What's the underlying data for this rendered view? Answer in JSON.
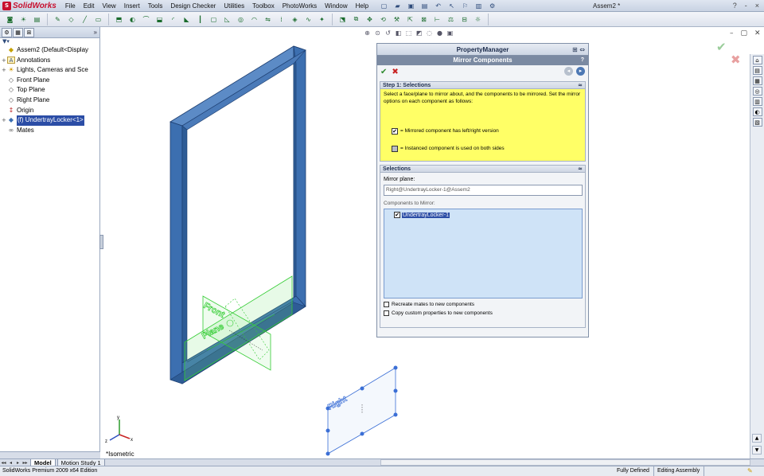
{
  "app": {
    "logo_text": "SolidWorks",
    "logo_mark": "S",
    "document_title": "Assem2 *",
    "help_glyphs": [
      "?",
      "-",
      "×"
    ]
  },
  "menus": [
    "File",
    "Edit",
    "View",
    "Insert",
    "Tools",
    "Design Checker",
    "Utilities",
    "Toolbox",
    "PhotoWorks",
    "Window",
    "Help"
  ],
  "feature_manager": {
    "tabs": [
      "⚙",
      "▦",
      "⊞"
    ],
    "expand_glyph": "»",
    "filter_glyph": "▼▾",
    "tree": [
      {
        "label": "Assem2  (Default<Display",
        "expander": "",
        "icon": "◆"
      },
      {
        "label": "Annotations",
        "expander": "+",
        "icon": "A"
      },
      {
        "label": "Lights, Cameras and Sce",
        "expander": "+",
        "icon": "☀"
      },
      {
        "label": "Front Plane",
        "expander": "",
        "icon": "◇"
      },
      {
        "label": "Top Plane",
        "expander": "",
        "icon": "◇"
      },
      {
        "label": "Right Plane",
        "expander": "",
        "icon": "◇"
      },
      {
        "label": "Origin",
        "expander": "",
        "icon": "↕"
      },
      {
        "label": "(f) UndertrayLocker<1>",
        "expander": "+",
        "icon": "◆",
        "selected": true
      },
      {
        "label": "Mates",
        "expander": "",
        "icon": "∞"
      }
    ]
  },
  "property_manager": {
    "header": "PropertyManager",
    "title": "Mirror Components",
    "help": "?",
    "ok_glyph": "✔",
    "cancel_glyph": "✖",
    "back_glyph": "◂",
    "next_glyph": "▸",
    "step1": {
      "heading": "Step 1: Selections",
      "instructions": "Select a face/plane to mirror about, and the components to be mirrored. Set the mirror options on each component as follows:",
      "legend_mirrored": "= Mirrored component has left/right version",
      "legend_instanced": "= Instanced component is used on both sides"
    },
    "selections": {
      "heading": "Selections",
      "mirror_plane_label": "Mirror plane:",
      "mirror_plane_value": "Right@UndertrayLocker-1@Assem2",
      "components_label": "Components to Mirror:",
      "components": [
        "UndertrayLocker-1"
      ]
    },
    "options": [
      {
        "label": "Recreate mates to new components",
        "checked": false
      },
      {
        "label": "Copy custom properties to new components",
        "checked": false
      }
    ]
  },
  "graphics": {
    "plane_labels": [
      "Front",
      "Plane",
      "Right"
    ],
    "view_label": "*Isometric",
    "triad_labels": {
      "x": "x",
      "y": "y",
      "z": "z"
    }
  },
  "bottom_tabs": [
    "Model",
    "Motion Study 1"
  ],
  "status": {
    "edition": "SolidWorks Premium 2009 x64 Edition",
    "defined": "Fully Defined",
    "editing": "Editing Assembly"
  },
  "colors": {
    "frame_blue": "#3c6fb0",
    "frame_edge": "#1d3e70",
    "front_plane_green": "#33cc33",
    "right_plane_blue": "#3b6fd6",
    "step1_yellow": "#ffff66",
    "selection_blue": "#2b4da6"
  }
}
